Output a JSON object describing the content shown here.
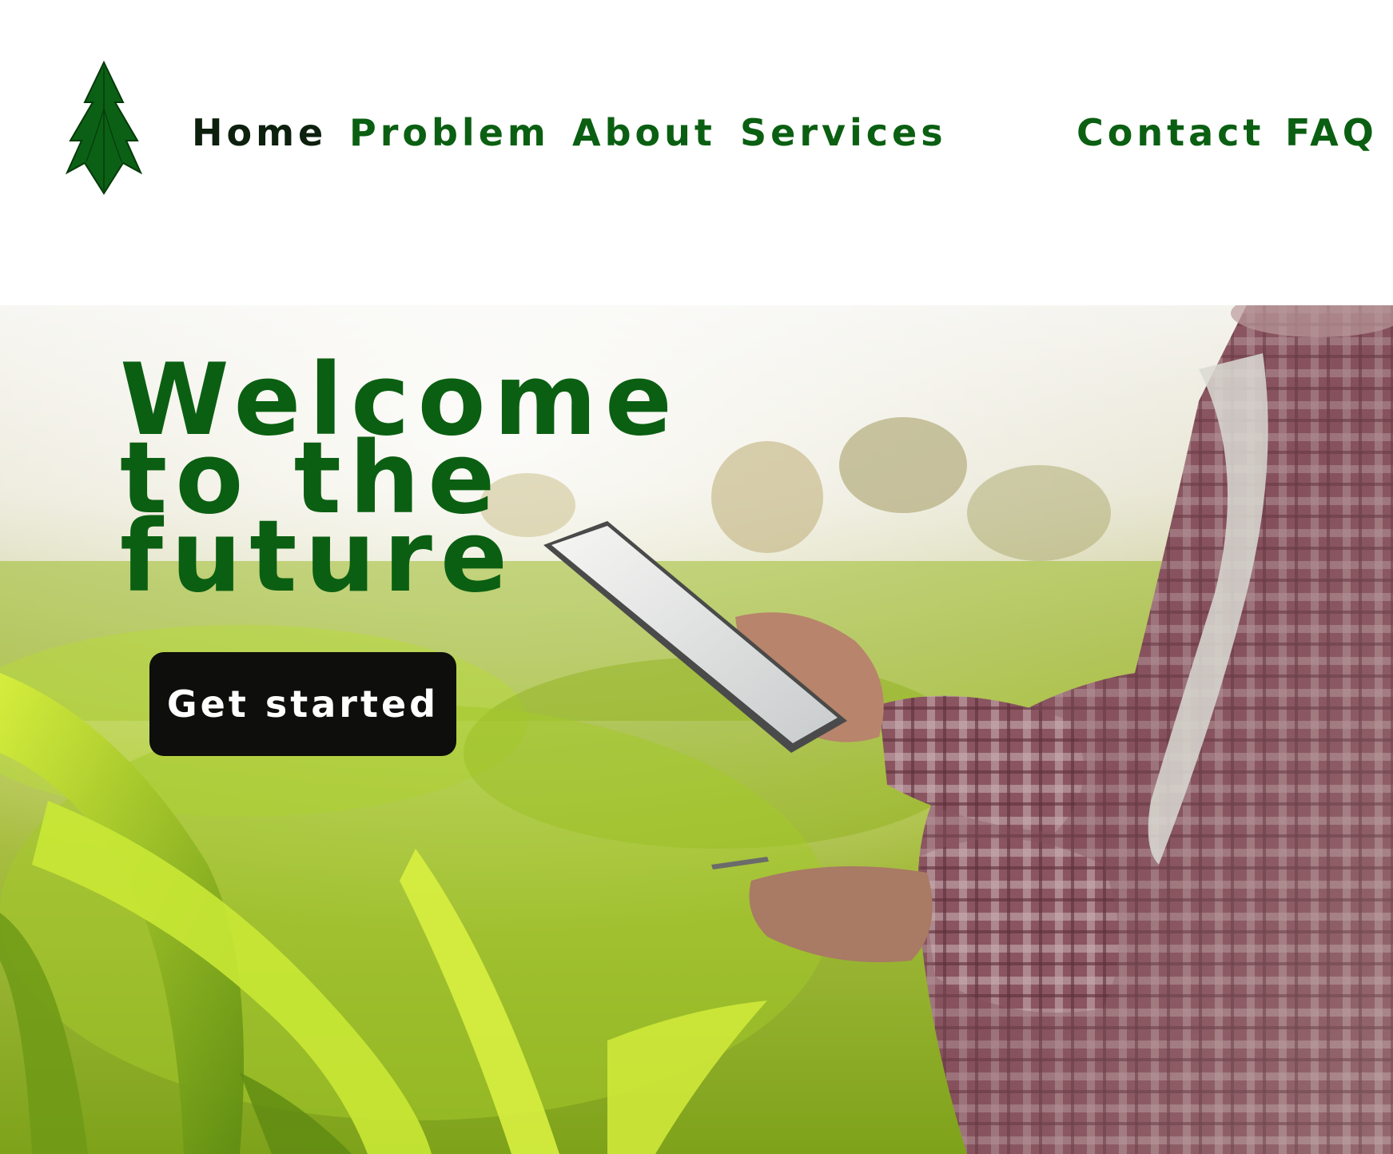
{
  "header": {
    "logo_icon": "leaf-arrow-logo-icon",
    "nav": {
      "home": "Home",
      "problem": "Problem",
      "about": "About",
      "services": "Services",
      "contact": "Contact",
      "faq": "FAQ"
    }
  },
  "hero": {
    "title_lines": [
      "Welcome",
      "to the",
      "future"
    ],
    "cta_label": "Get started",
    "background_description_icon": "farmer-with-tablet-in-field-photo"
  },
  "colors": {
    "brand_green": "#0b5f12",
    "nav_home": "#0d1f0d",
    "cta_bg": "#0e0e0c",
    "cta_text": "#ffffff"
  }
}
